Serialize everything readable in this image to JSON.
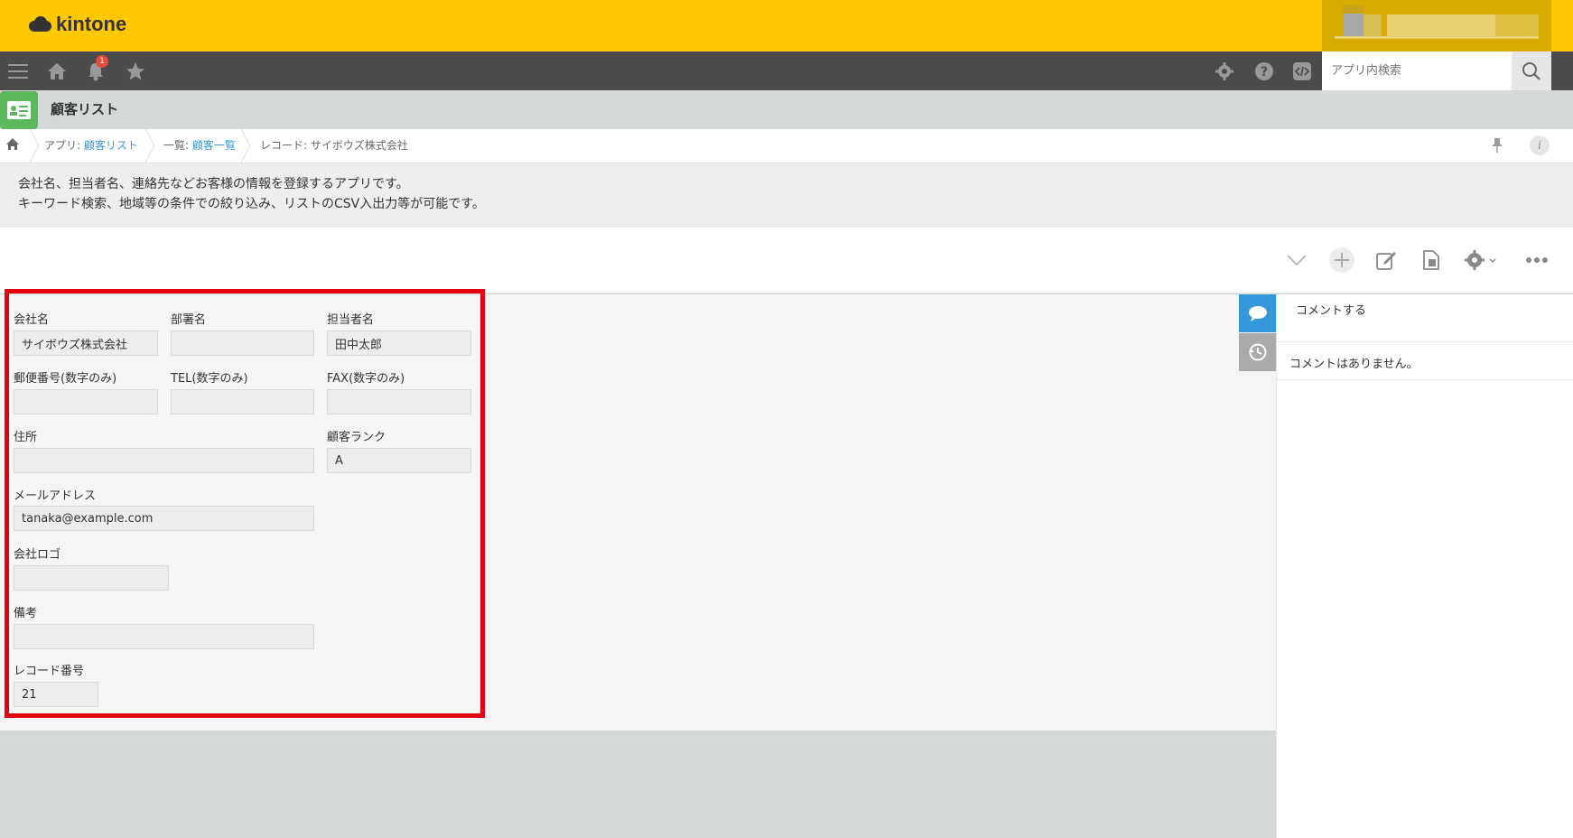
{
  "header": {
    "logo_text": "kintone",
    "notification_count": "1"
  },
  "search": {
    "placeholder": "アプリ内検索"
  },
  "app": {
    "title": "顧客リスト"
  },
  "breadcrumb": {
    "app_prefix": "アプリ: ",
    "app_link": "顧客リスト",
    "view_prefix": "一覧: ",
    "view_link": "顧客一覧",
    "record_label": "レコード: サイボウズ株式会社"
  },
  "description": {
    "line1": "会社名、担当者名、連絡先などお客様の情報を登録するアプリです。",
    "line2": "キーワード検索、地域等の条件での絞り込み、リストのCSV入出力等が可能です。"
  },
  "form": {
    "company_label": "会社名",
    "company_value": "サイボウズ株式会社",
    "dept_label": "部署名",
    "dept_value": "",
    "person_label": "担当者名",
    "person_value": "田中太郎",
    "zip_label": "郵便番号(数字のみ)",
    "zip_value": "",
    "tel_label": "TEL(数字のみ)",
    "tel_value": "",
    "fax_label": "FAX(数字のみ)",
    "fax_value": "",
    "address_label": "住所",
    "address_value": "",
    "rank_label": "顧客ランク",
    "rank_value": "A",
    "email_label": "メールアドレス",
    "email_value": "tanaka@example.com",
    "logo_label": "会社ロゴ",
    "logo_value": "",
    "note_label": "備考",
    "note_value": "",
    "record_no_label": "レコード番号",
    "record_no_value": "21"
  },
  "comments": {
    "post_label": "コメントする",
    "empty_label": "コメントはありません。"
  },
  "colors": {
    "header": "#ffc800",
    "gnav": "#4b4b4b",
    "link": "#3498db",
    "highlight": "#e60012",
    "comment_tab": "#3498db"
  },
  "icons": [
    "menu-icon",
    "home-icon",
    "bell-icon",
    "star-icon",
    "gear-icon",
    "help-icon",
    "code-icon",
    "search-icon",
    "pin-icon",
    "info-icon",
    "chevron-down-icon",
    "plus-icon",
    "edit-icon",
    "copy-icon",
    "more-icon",
    "comment-icon",
    "history-icon"
  ]
}
